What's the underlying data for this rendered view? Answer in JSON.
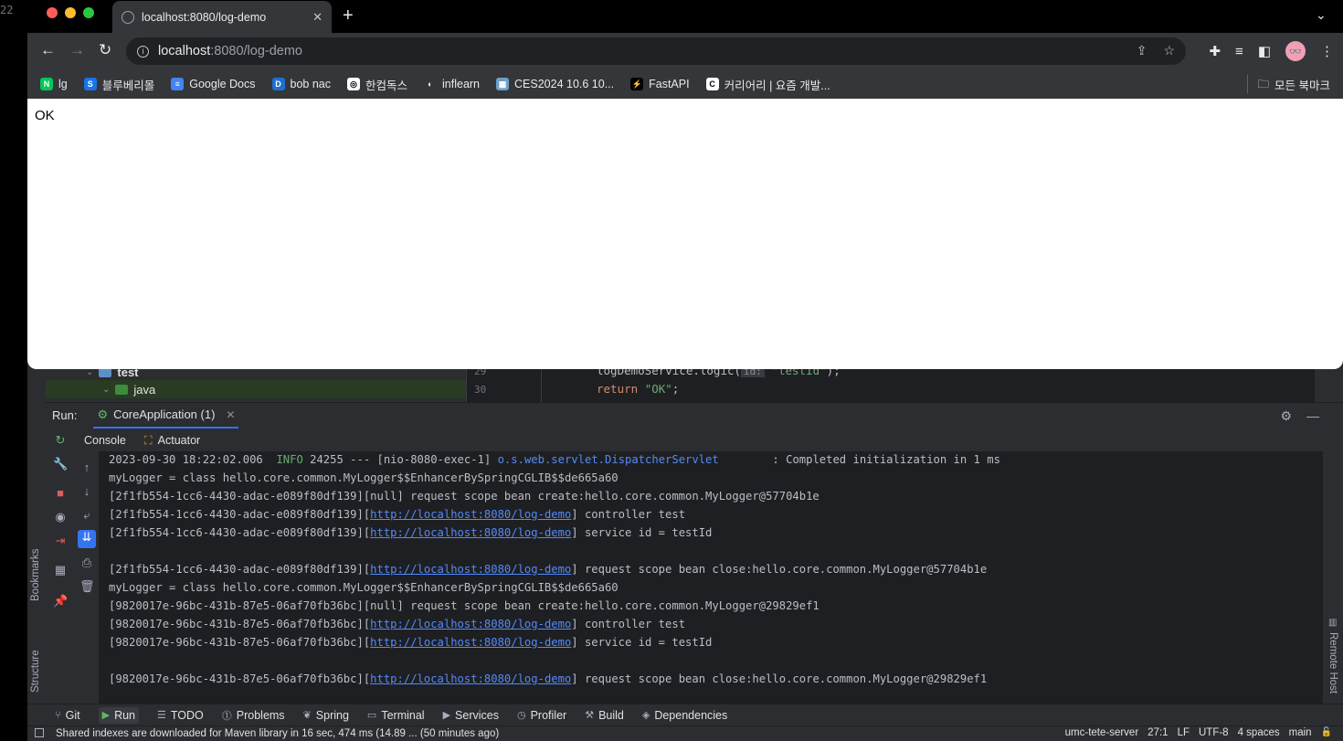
{
  "edge": {
    "line_number": "22"
  },
  "browser": {
    "tab_title": "localhost:8080/log-demo",
    "url_host": "localhost",
    "url_path": ":8080/log-demo",
    "bookmarks": [
      {
        "label": "lg",
        "icon": "naver-icon",
        "color": "#03c75a",
        "glyph": "N"
      },
      {
        "label": "블루베리몰",
        "icon": "s-icon",
        "color": "#1a73e8",
        "glyph": "S"
      },
      {
        "label": "Google Docs",
        "icon": "docs-icon",
        "color": "#4285f4",
        "glyph": "≡"
      },
      {
        "label": "bob nac",
        "icon": "dsm-icon",
        "color": "#1f6fd1",
        "glyph": "D"
      },
      {
        "label": "한컴독스",
        "icon": "hancom-icon",
        "color": "#ffffff",
        "glyph": "◎"
      },
      {
        "label": "inflearn",
        "icon": "inflearn-icon",
        "color": "#35363a",
        "glyph": "◐"
      },
      {
        "label": "CES2024 10.6 10...",
        "icon": "ces-icon",
        "color": "#6ea0c8",
        "glyph": "▦"
      },
      {
        "label": "FastAPI",
        "icon": "fastapi-icon",
        "color": "#000000",
        "glyph": "⚡"
      },
      {
        "label": "커리어리 | 요즘 개발...",
        "icon": "careerly-icon",
        "color": "#ffffff",
        "glyph": "C"
      }
    ],
    "all_bookmarks": "모든 북마크",
    "page_text": "OK"
  },
  "ide": {
    "tree": {
      "test_folder": "test",
      "java_folder": "java"
    },
    "line_numbers": [
      "29",
      "30"
    ],
    "code_line_1_obj": "logDemoService",
    "code_line_1_method": ".logic(",
    "code_line_1_hint": "id:",
    "code_line_1_arg": "\"testId\"",
    "code_line_1_end": ");",
    "code_line_2_kw": "return",
    "code_line_2_str": "\"OK\"",
    "code_line_2_end": ";",
    "run_label": "Run:",
    "run_tab": "CoreApplication (1)",
    "sub_tabs": [
      "Console",
      "Actuator"
    ],
    "console": [
      {
        "pre": "2023-09-30 18:22:02.006  ",
        "info": "INFO",
        "post": " 24255 --- [nio-8080-exec-1] ",
        "cls": "o.s.web.servlet.DispatcherServlet",
        "tail": "        : Completed initialization in 1 ms"
      },
      {
        "pre": "myLogger = class hello.core.common.MyLogger$$EnhancerBySpringCGLIB$$de665a60"
      },
      {
        "pre": "[2f1fb554-1cc6-4430-adac-e089f80df139][null] request scope bean create:hello.core.common.MyLogger@57704b1e"
      },
      {
        "pre": "[2f1fb554-1cc6-4430-adac-e089f80df139][",
        "link": "http://localhost:8080/log-demo",
        "tail": "] controller test"
      },
      {
        "pre": "[2f1fb554-1cc6-4430-adac-e089f80df139][",
        "link": "http://localhost:8080/log-demo",
        "tail": "] service id = testId"
      },
      {
        "pre": ""
      },
      {
        "pre": "[2f1fb554-1cc6-4430-adac-e089f80df139][",
        "link": "http://localhost:8080/log-demo",
        "tail": "] request scope bean close:hello.core.common.MyLogger@57704b1e"
      },
      {
        "pre": "myLogger = class hello.core.common.MyLogger$$EnhancerBySpringCGLIB$$de665a60"
      },
      {
        "pre": "[9820017e-96bc-431b-87e5-06af70fb36bc][null] request scope bean create:hello.core.common.MyLogger@29829ef1"
      },
      {
        "pre": "[9820017e-96bc-431b-87e5-06af70fb36bc][",
        "link": "http://localhost:8080/log-demo",
        "tail": "] controller test"
      },
      {
        "pre": "[9820017e-96bc-431b-87e5-06af70fb36bc][",
        "link": "http://localhost:8080/log-demo",
        "tail": "] service id = testId"
      },
      {
        "pre": ""
      },
      {
        "pre": "[9820017e-96bc-431b-87e5-06af70fb36bc][",
        "link": "http://localhost:8080/log-demo",
        "tail": "] request scope bean close:hello.core.common.MyLogger@29829ef1"
      }
    ],
    "side_labels": {
      "bookmarks": "Bookmarks",
      "structure": "Structure",
      "remote_host": "Remote Host"
    },
    "bottom_tools": [
      "Git",
      "Run",
      "TODO",
      "Problems",
      "Spring",
      "Terminal",
      "Services",
      "Profiler",
      "Build",
      "Dependencies"
    ],
    "status_message": "Shared indexes are downloaded for Maven library in 16 sec, 474 ms (14.89 ... (50 minutes ago)",
    "status_right": [
      "umc-tete-server",
      "27:1",
      "LF",
      "UTF-8",
      "4 spaces",
      "main"
    ]
  }
}
